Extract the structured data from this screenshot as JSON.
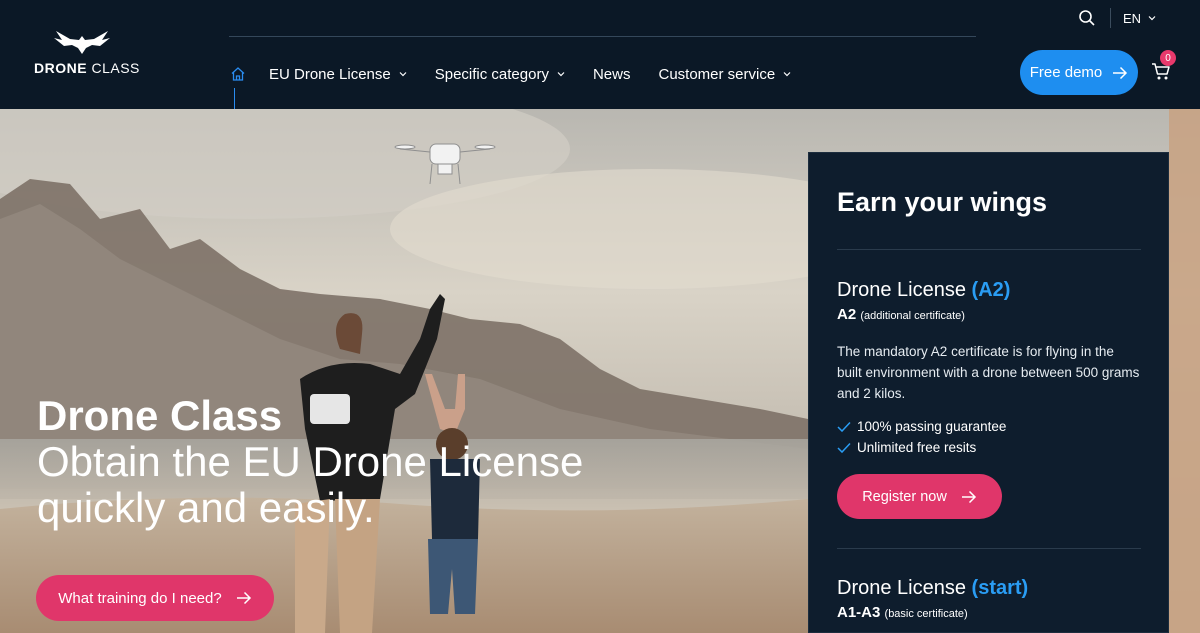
{
  "header": {
    "logo_text_bold": "DRONE",
    "logo_text_light": "CLASS",
    "nav": [
      {
        "label": "EU Drone License",
        "has_dropdown": true
      },
      {
        "label": "Specific category",
        "has_dropdown": true
      },
      {
        "label": "News",
        "has_dropdown": false
      },
      {
        "label": "Customer service",
        "has_dropdown": true
      }
    ],
    "language": "EN",
    "demo_button": "Free demo",
    "cart_count": "0"
  },
  "hero": {
    "title": "Drone Class",
    "subtitle": "Obtain the EU Drone License quickly and easily.",
    "cta": "What training do I need?"
  },
  "panel": {
    "title": "Earn your wings",
    "licenses": [
      {
        "name": "Drone License",
        "code": "(A2)",
        "level": "A2",
        "level_note": "(additional certificate)",
        "description": "The mandatory A2 certificate is for flying in the built environment with a drone between 500 grams and 2 kilos.",
        "features": [
          "100% passing guarantee",
          "Unlimited free resits"
        ],
        "button": "Register now"
      },
      {
        "name": "Drone License",
        "code": "(start)",
        "level": "A1-A3",
        "level_note": "(basic certificate)"
      }
    ]
  },
  "colors": {
    "header_bg": "#0b1826",
    "accent_blue": "#1e8ef0",
    "accent_pink": "#e0366a",
    "panel_bg": "#0e1d2d"
  },
  "icons": [
    "home-icon",
    "chevron-down-icon",
    "search-icon",
    "arrow-right-icon",
    "cart-icon",
    "check-icon",
    "eagle-logo-icon"
  ]
}
